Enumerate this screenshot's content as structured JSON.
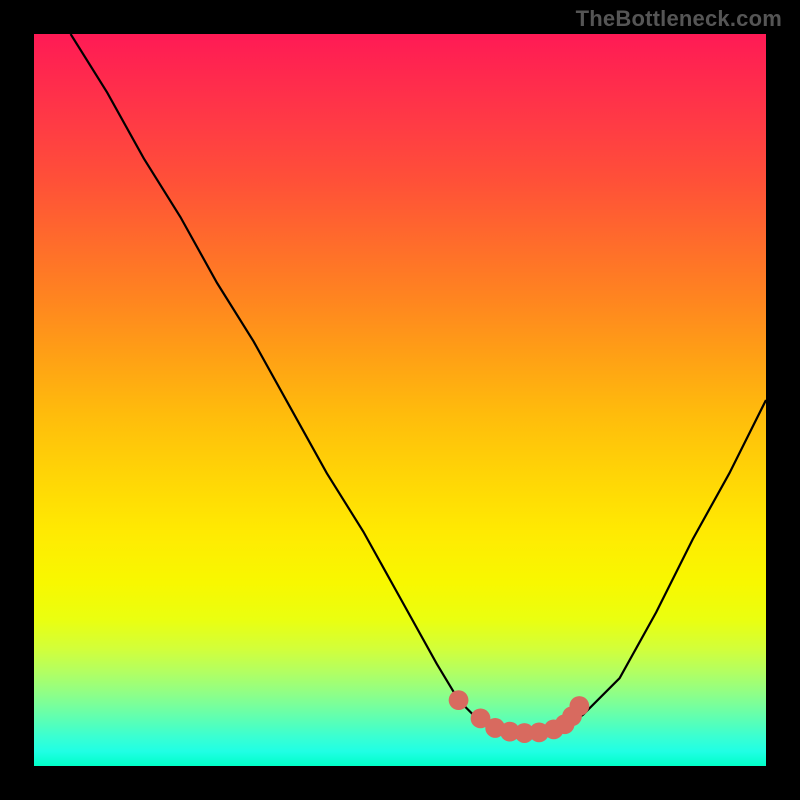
{
  "attribution": "TheBottleneck.com",
  "colors": {
    "background": "#000000",
    "curve": "#000000",
    "dots": "#d86a5f",
    "gradient_top": "#ff1a55",
    "gradient_bottom": "#00ffc8"
  },
  "chart_data": {
    "type": "line",
    "title": "",
    "xlabel": "",
    "ylabel": "",
    "xlim": [
      0,
      100
    ],
    "ylim": [
      0,
      100
    ],
    "series": [
      {
        "name": "bottleneck-curve",
        "x": [
          5,
          10,
          15,
          20,
          25,
          30,
          35,
          40,
          45,
          50,
          55,
          58,
          60,
          63,
          66,
          69,
          72,
          75,
          80,
          85,
          90,
          95,
          100
        ],
        "y": [
          100,
          92,
          83,
          75,
          66,
          58,
          49,
          40,
          32,
          23,
          14,
          9,
          7,
          5,
          4.5,
          4.5,
          5,
          7,
          12,
          21,
          31,
          40,
          50
        ]
      }
    ],
    "highlight_points": {
      "name": "optimal-range",
      "x": [
        58,
        61,
        63,
        65,
        67,
        69,
        71,
        72.5,
        73.5,
        74.5
      ],
      "y": [
        9,
        6.5,
        5.2,
        4.7,
        4.5,
        4.6,
        5,
        5.7,
        6.8,
        8.2
      ]
    }
  }
}
